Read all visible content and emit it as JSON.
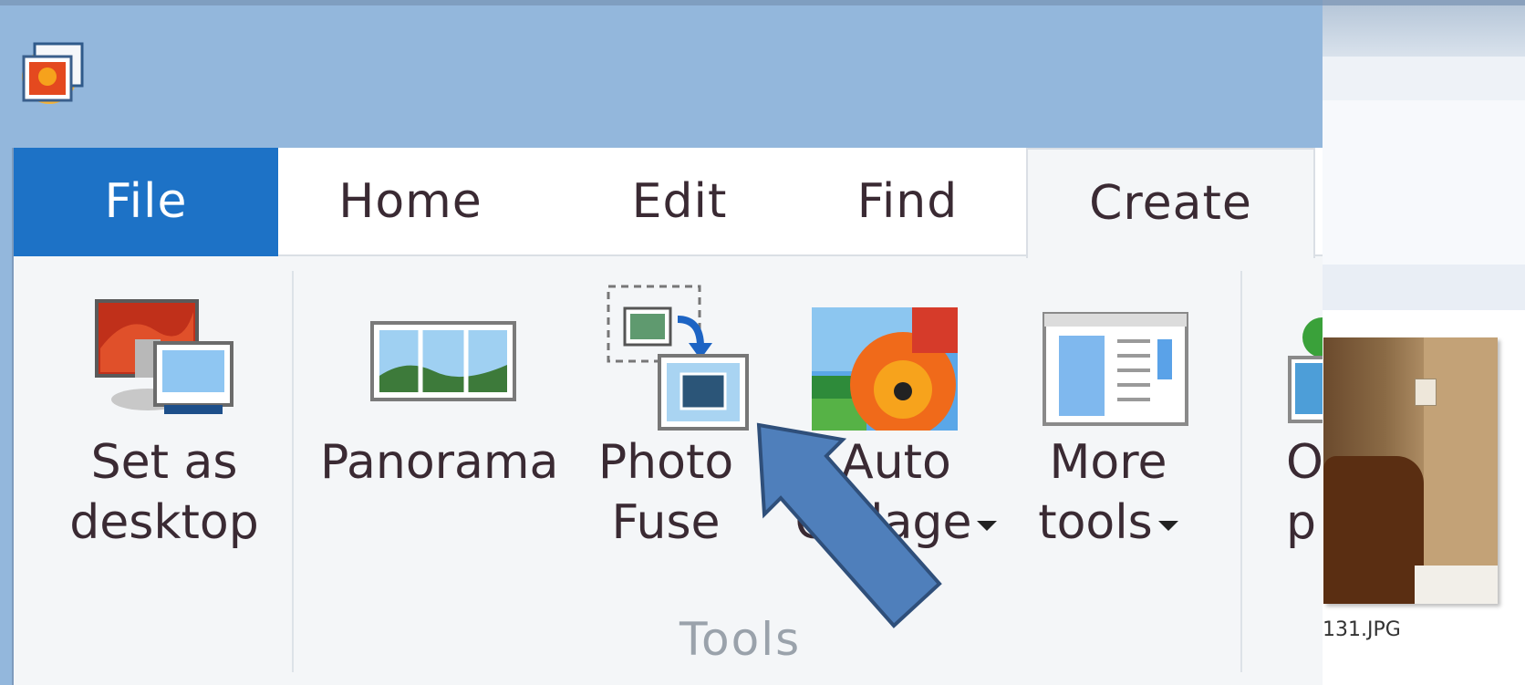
{
  "ribbon": {
    "tabs": [
      {
        "label": "File"
      },
      {
        "label": "Home"
      },
      {
        "label": "Edit"
      },
      {
        "label": "Find"
      },
      {
        "label": "Create"
      }
    ],
    "commands": {
      "set_as_desktop": {
        "line1": "Set as",
        "line2": "desktop"
      },
      "panorama": {
        "line1": "Panorama"
      },
      "photo_fuse": {
        "line1": "Photo",
        "line2": "Fuse"
      },
      "auto_collage": {
        "line1": "Auto",
        "line2": "Collage"
      },
      "more_tools": {
        "line1": "More",
        "line2": "tools"
      },
      "partial": {
        "line1": "O",
        "line2": "p"
      }
    },
    "group_label": "Tools"
  },
  "background_window": {
    "thumbnail_filename": "131.JPG"
  },
  "colors": {
    "file_tab": "#1d72c6",
    "title_bar": "#93b7dc",
    "pointer_arrow": "#4f7fbb"
  },
  "icons": [
    "app-icon",
    "set-as-desktop-icon",
    "panorama-icon",
    "photo-fuse-icon",
    "auto-collage-icon",
    "more-tools-icon",
    "partial-tool-icon",
    "pointer-arrow"
  ]
}
